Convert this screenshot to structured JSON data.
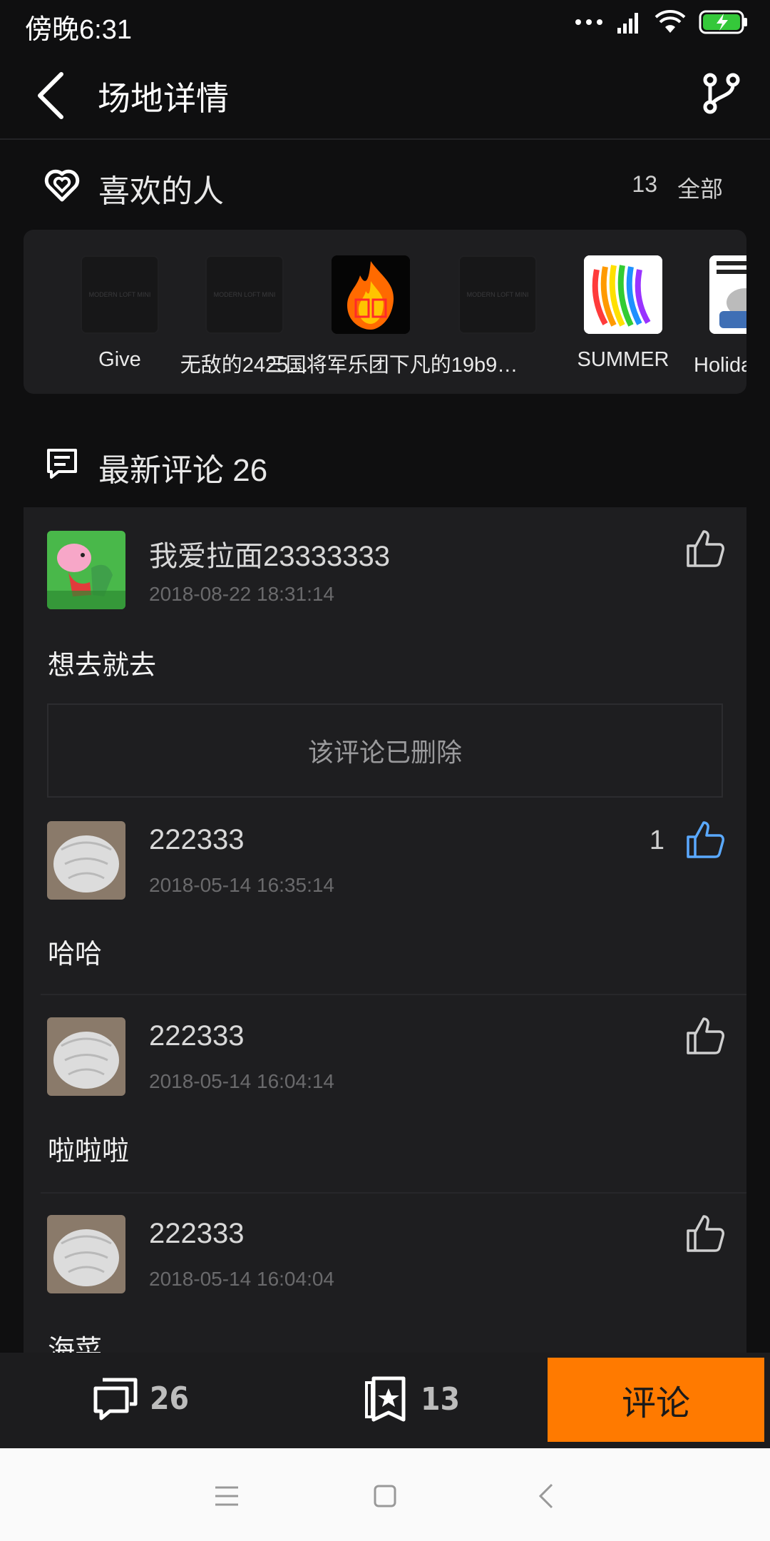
{
  "status_bar": {
    "time": "傍晚6:31"
  },
  "header": {
    "title": "场地详情"
  },
  "likes_section": {
    "title": "喜欢的人",
    "count": "13",
    "all_label": "全部",
    "users": [
      {
        "name": "Give",
        "avatar": "placeholder"
      },
      {
        "name": "无敌的2425…",
        "avatar": "placeholder"
      },
      {
        "name": "三国将军乐团",
        "avatar": "flame"
      },
      {
        "name": "下凡的19b9…",
        "avatar": "placeholder"
      },
      {
        "name": "SUMMER",
        "avatar": "color-fans"
      },
      {
        "name": "Holiday 小",
        "avatar": "cartoon"
      }
    ],
    "placeholder_text": "MODERN LOFT MINI"
  },
  "comments_section": {
    "title": "最新评论 26",
    "deleted_text": "该评论已删除",
    "comments": [
      {
        "author": "我爱拉面23333333",
        "time": "2018-08-22 18:31:14",
        "text": "想去就去",
        "likes": "",
        "liked": false
      },
      {
        "author": "222333",
        "time": "2018-05-14 16:35:14",
        "text": "哈哈",
        "likes": "1",
        "liked": true
      },
      {
        "author": "222333",
        "time": "2018-05-14 16:04:14",
        "text": "啦啦啦",
        "likes": "",
        "liked": false
      },
      {
        "author": "222333",
        "time": "2018-05-14 16:04:04",
        "text": "海菜",
        "likes": "",
        "liked": false
      }
    ]
  },
  "bottom_bar": {
    "comments_count": "26",
    "favorites_count": "13",
    "comment_button": "评论"
  },
  "colors": {
    "accent": "#ff7a00",
    "liked_blue": "#5aa9ff",
    "background": "#0f0f10",
    "card": "#1e1e20"
  }
}
